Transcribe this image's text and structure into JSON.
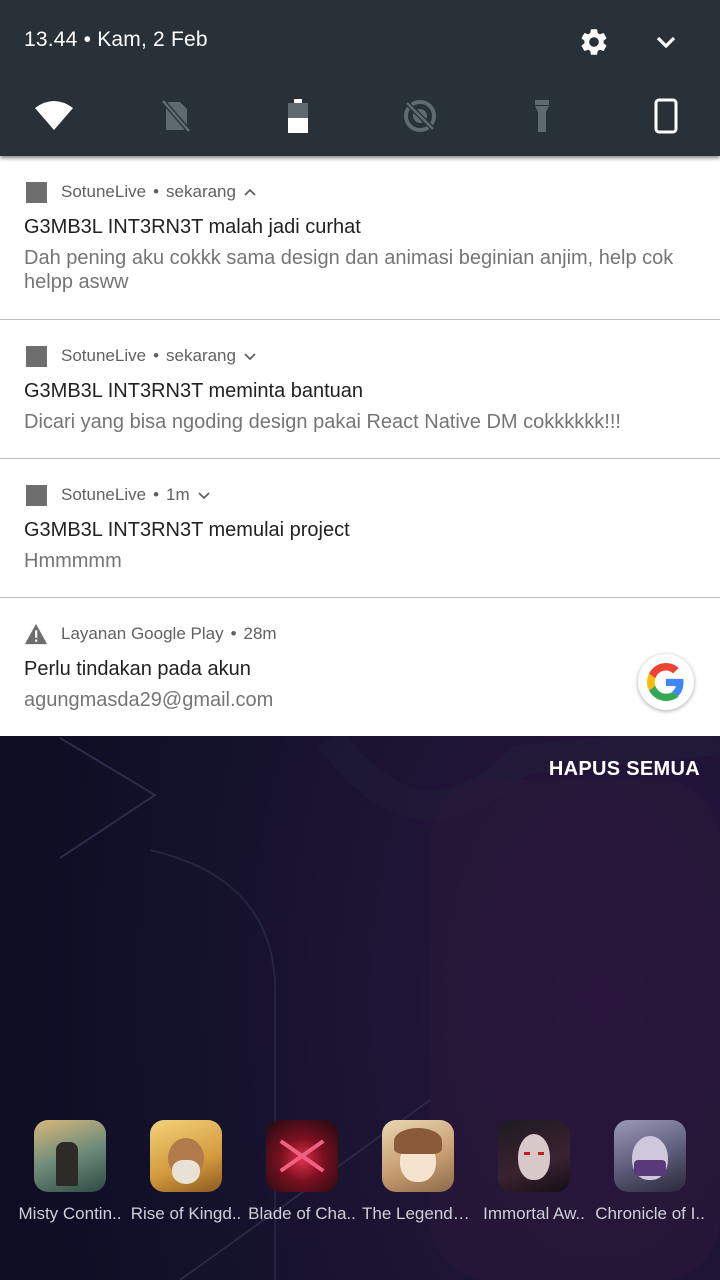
{
  "status": {
    "time": "13.44",
    "date": "Kam, 2 Feb"
  },
  "quick_tiles": [
    {
      "name": "wifi-icon"
    },
    {
      "name": "no-sim-icon"
    },
    {
      "name": "battery-icon"
    },
    {
      "name": "data-saver-off-icon"
    },
    {
      "name": "flashlight-icon"
    },
    {
      "name": "portrait-rotation-icon"
    }
  ],
  "notifications": [
    {
      "app": "SotuneLive",
      "time": "sekarang",
      "title": "G3MB3L INT3RN3T malah jadi curhat",
      "body": "Dah pening aku cokkk sama design dan animasi beginian anjim, help cok helpp asww",
      "expanded": true
    },
    {
      "app": "SotuneLive",
      "time": "sekarang",
      "title": "G3MB3L INT3RN3T meminta bantuan",
      "body": "Dicari yang bisa ngoding design pakai React Native DM cokkkkkk!!!",
      "expanded": false
    },
    {
      "app": "SotuneLive",
      "time": "1m",
      "title": "G3MB3L INT3RN3T memulai project",
      "body": "Hmmmmm",
      "expanded": false
    },
    {
      "app": "Layanan Google Play",
      "time": "28m",
      "title": "Perlu tindakan pada akun",
      "body": "agungmasda29@gmail.com"
    }
  ],
  "clear_all": "HAPUS SEMUA",
  "apps": [
    {
      "label": "Misty Contin..",
      "color": "#5d7a6e"
    },
    {
      "label": "Rise of Kingd..",
      "color": "#c49a4a"
    },
    {
      "label": "Blade of Cha..",
      "color": "#7a1424"
    },
    {
      "label": "The Legend o..",
      "color": "#c9a57e"
    },
    {
      "label": "Immortal Aw..",
      "color": "#3a2230"
    },
    {
      "label": "Chronicle of I..",
      "color": "#5b5a78"
    }
  ]
}
